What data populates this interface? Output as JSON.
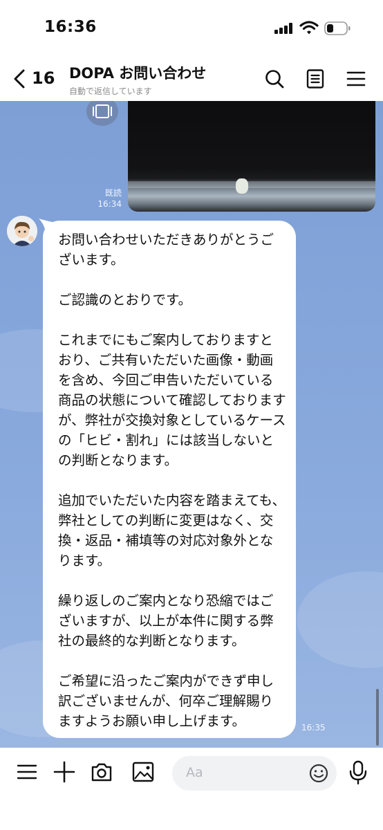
{
  "status_bar": {
    "time": "16:36"
  },
  "header": {
    "back_count": "16",
    "title": "DOPA お問い合わせ",
    "subtitle": "自動で返信しています",
    "icons": [
      "search-icon",
      "note-icon",
      "menu-icon"
    ]
  },
  "chat": {
    "sent_image": {
      "read_label": "既読",
      "time": "16:34"
    },
    "reply": {
      "text": "お問い合わせいただきありがとうございます。\n\nご認識のとおりです。\n\nこれまでにもご案内しておりますとおり、ご共有いただいた画像・動画を含め、今回ご申告いただいている商品の状態について確認しておりますが、弊社が交換対象としているケースの「ヒビ・割れ」には該当しないとの判断となります。\n\n追加でいただいた内容を踏まえても、弊社としての判断に変更はなく、交換・返品・補填等の対応対象外となります。\n\n繰り返しのご案内となり恐縮ではございますが、以上が本件に関する弊社の最終的な判断となります。\n\nご希望に沿ったご案内ができず申し訳ございませんが、何卒ご理解賜りますようお願い申し上げます。",
      "time": "16:35"
    }
  },
  "input_bar": {
    "placeholder": "Aa",
    "icons": [
      "menu-icon",
      "plus-icon",
      "camera-icon",
      "image-icon",
      "emoji-icon",
      "mic-icon"
    ]
  },
  "colors": {
    "chat_background": "#8aaadd",
    "bubble": "#ffffff"
  }
}
